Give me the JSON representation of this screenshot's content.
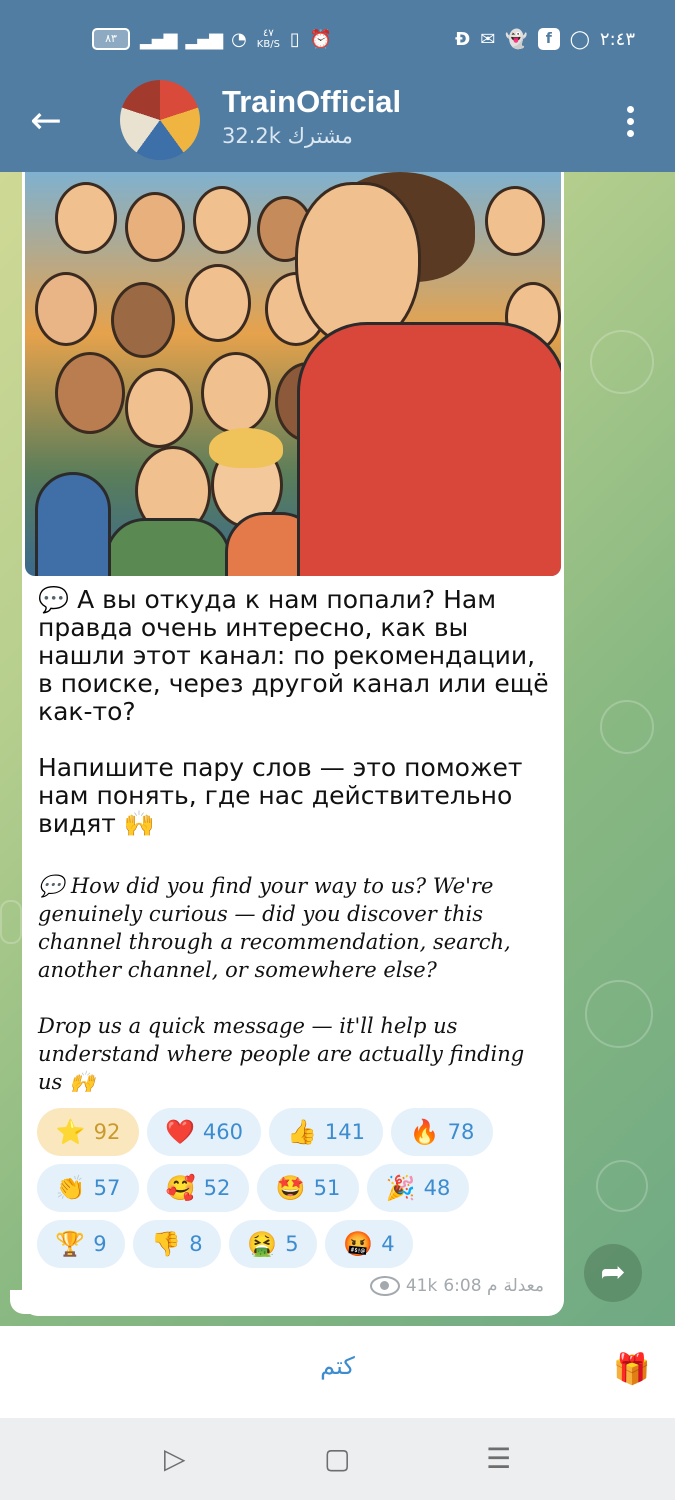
{
  "statusbar": {
    "battery": "٨٣",
    "speed": "٤٧\nKB/S",
    "time": "٢:٤٣",
    "icons": [
      "signal-icon",
      "signal-icon",
      "wifi-icon",
      "vibrate-icon",
      "alarm-icon",
      "d-app-icon",
      "mail-icon",
      "snapchat-icon",
      "facebook-icon",
      "whatsapp-icon"
    ]
  },
  "header": {
    "title": "TrainOfficial",
    "subtitle": "32.2k مشترك"
  },
  "message": {
    "ru_p1": "💬 А вы откуда к нам попали? Нам правда очень интересно, как вы нашли этот канал: по рекомендации, в поиске, через другой канал или ещё как-то?",
    "ru_p2": "Напишите пару слов — это поможет нам понять, где нас действительно видят 🙌",
    "en_p1": "💬 How did you find your way to us? We're genuinely curious — did you discover this channel through a recommendation, search, another channel, or somewhere else?",
    "en_p2": "Drop us a quick message — it'll help us understand where people are actually finding us 🙌",
    "views": "41k",
    "time": "6:08 م",
    "edited": "معدلة"
  },
  "reactions": [
    {
      "emoji": "⭐",
      "count": "92",
      "name": "star"
    },
    {
      "emoji": "❤️",
      "count": "460",
      "name": "heart"
    },
    {
      "emoji": "👍",
      "count": "141",
      "name": "thumbs-up"
    },
    {
      "emoji": "🔥",
      "count": "78",
      "name": "fire"
    },
    {
      "emoji": "👏",
      "count": "57",
      "name": "clap"
    },
    {
      "emoji": "🥰",
      "count": "52",
      "name": "smiling-hearts"
    },
    {
      "emoji": "🤩",
      "count": "51",
      "name": "star-struck"
    },
    {
      "emoji": "🎉",
      "count": "48",
      "name": "party"
    },
    {
      "emoji": "🏆",
      "count": "9",
      "name": "trophy"
    },
    {
      "emoji": "👎",
      "count": "8",
      "name": "thumbs-down"
    },
    {
      "emoji": "🤮",
      "count": "5",
      "name": "vomit"
    },
    {
      "emoji": "🤬",
      "count": "4",
      "name": "cursing"
    }
  ],
  "bottom": {
    "mute_label": "كتم"
  },
  "colors": {
    "header": "#517da2",
    "accent": "#3d8ccf",
    "selected_reaction": "#fbe7bd"
  }
}
